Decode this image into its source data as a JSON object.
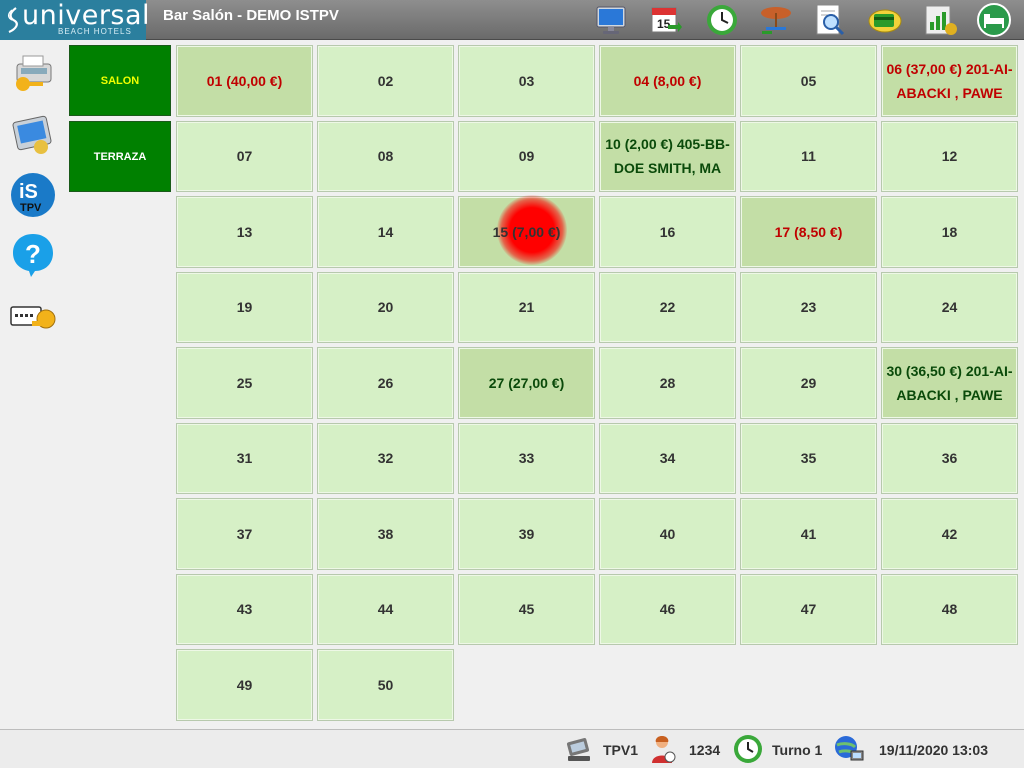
{
  "header": {
    "logo_text": "universal",
    "logo_sub": "BEACH HOTELS",
    "title": "Bar Salón - DEMO ISTPV",
    "icons": [
      "monitor-icon",
      "calendar-icon",
      "clock-refresh-icon",
      "umbrella-table-icon",
      "search-document-icon",
      "payment-card-icon",
      "report-chart-icon",
      "bed-exit-icon"
    ],
    "calendar_day": "15"
  },
  "sidebar": {
    "icons": [
      "cash-register-icon",
      "terminal-icon",
      "istpv-logo-icon",
      "help-icon",
      "key-card-icon"
    ],
    "istpv_top": "iS",
    "istpv_bottom": "TPV",
    "help_glyph": "?"
  },
  "areas": [
    {
      "label": "SALON",
      "active": true
    },
    {
      "label": "TERRAZA",
      "active": false
    }
  ],
  "tables": [
    {
      "label": "01 (40,00 €)",
      "state": "red"
    },
    {
      "label": "02",
      "state": "free"
    },
    {
      "label": "03",
      "state": "free"
    },
    {
      "label": "04 (8,00 €)",
      "state": "red"
    },
    {
      "label": "05",
      "state": "free"
    },
    {
      "label": "06 (37,00 €) 201-AI-ABACKI , PAWE",
      "state": "red"
    },
    {
      "label": "07",
      "state": "free"
    },
    {
      "label": "08",
      "state": "free"
    },
    {
      "label": "09",
      "state": "free"
    },
    {
      "label": "10 (2,00 €) 405-BB-DOE SMITH, MA",
      "state": "green"
    },
    {
      "label": "11",
      "state": "free"
    },
    {
      "label": "12",
      "state": "free"
    },
    {
      "label": "13",
      "state": "free"
    },
    {
      "label": "14",
      "state": "free"
    },
    {
      "label": "15 (7,00 €)",
      "state": "alert"
    },
    {
      "label": "16",
      "state": "free"
    },
    {
      "label": "17 (8,50 €)",
      "state": "red"
    },
    {
      "label": "18",
      "state": "free"
    },
    {
      "label": "19",
      "state": "free"
    },
    {
      "label": "20",
      "state": "free"
    },
    {
      "label": "21",
      "state": "free"
    },
    {
      "label": "22",
      "state": "free"
    },
    {
      "label": "23",
      "state": "free"
    },
    {
      "label": "24",
      "state": "free"
    },
    {
      "label": "25",
      "state": "free"
    },
    {
      "label": "26",
      "state": "free"
    },
    {
      "label": "27 (27,00 €)",
      "state": "green"
    },
    {
      "label": "28",
      "state": "free"
    },
    {
      "label": "29",
      "state": "free"
    },
    {
      "label": "30 (36,50 €) 201-AI-ABACKI , PAWE",
      "state": "green"
    },
    {
      "label": "31",
      "state": "free"
    },
    {
      "label": "32",
      "state": "free"
    },
    {
      "label": "33",
      "state": "free"
    },
    {
      "label": "34",
      "state": "free"
    },
    {
      "label": "35",
      "state": "free"
    },
    {
      "label": "36",
      "state": "free"
    },
    {
      "label": "37",
      "state": "free"
    },
    {
      "label": "38",
      "state": "free"
    },
    {
      "label": "39",
      "state": "free"
    },
    {
      "label": "40",
      "state": "free"
    },
    {
      "label": "41",
      "state": "free"
    },
    {
      "label": "42",
      "state": "free"
    },
    {
      "label": "43",
      "state": "free"
    },
    {
      "label": "44",
      "state": "free"
    },
    {
      "label": "45",
      "state": "free"
    },
    {
      "label": "46",
      "state": "free"
    },
    {
      "label": "47",
      "state": "free"
    },
    {
      "label": "48",
      "state": "free"
    },
    {
      "label": "49",
      "state": "free"
    },
    {
      "label": "50",
      "state": "free"
    }
  ],
  "status": {
    "terminal": "TPV1",
    "user": "1234",
    "shift": "Turno 1",
    "datetime": "19/11/2020 13:03",
    "icons": [
      "pos-terminal-icon",
      "user-icon",
      "shift-clock-icon",
      "network-icon"
    ]
  },
  "colors": {
    "area_active": "#008000",
    "table_free": "#d6f0c6",
    "table_occupied": "#c3dea6",
    "text_red": "#c00000",
    "text_green": "#0a4a0a",
    "alert": "#ff0000"
  }
}
